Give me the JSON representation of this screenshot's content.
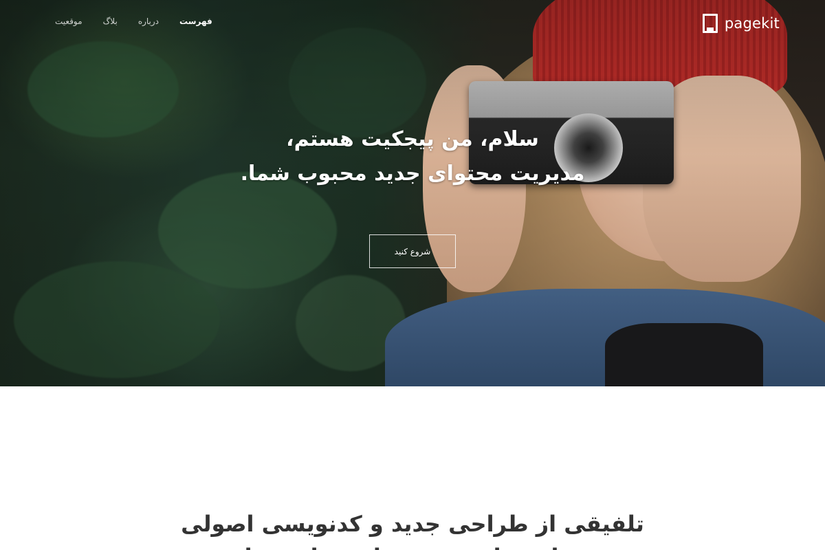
{
  "nav": {
    "logo_text": "pagekit",
    "menu": [
      {
        "label": "فهرست",
        "active": true
      },
      {
        "label": "درباره",
        "active": false
      },
      {
        "label": "بلاگ",
        "active": false
      },
      {
        "label": "موقعیت",
        "active": false
      }
    ]
  },
  "hero": {
    "title_line1": "سلام، من پیجکیت هستم،",
    "title_line2": "مدیریت محتوای جدید محبوب شما.",
    "cta_label": "شروع کنید"
  },
  "section": {
    "title_line1": "تلفیقی از طراحی جدید و کدنویسی اصولی",
    "title_line2": "برای ساخت وب سایت های زیبا"
  },
  "colors": {
    "hero_text": "#ffffff",
    "section_text": "#333333",
    "beanie": "#c8302c"
  }
}
